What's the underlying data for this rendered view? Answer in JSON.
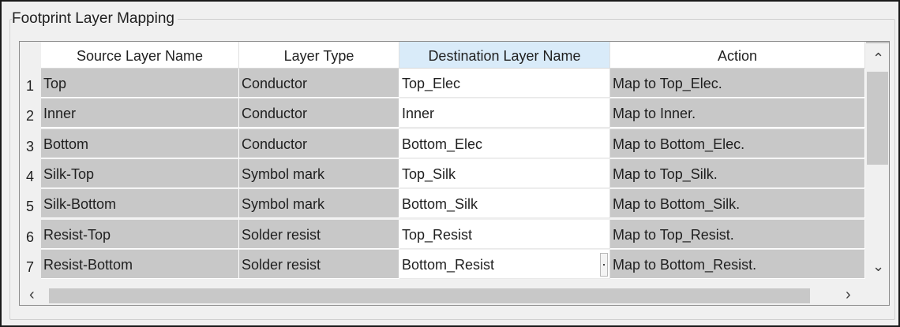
{
  "group": {
    "title": "Footprint Layer Mapping"
  },
  "columns": [
    "Source Layer Name",
    "Layer Type",
    "Destination Layer Name",
    "Action"
  ],
  "rows": [
    {
      "num": "1",
      "source": "Top",
      "type": "Conductor",
      "dest": "Top_Elec",
      "action": "Map to Top_Elec."
    },
    {
      "num": "2",
      "source": "Inner",
      "type": "Conductor",
      "dest": "Inner",
      "action": "Map to Inner."
    },
    {
      "num": "3",
      "source": "Bottom",
      "type": "Conductor",
      "dest": "Bottom_Elec",
      "action": "Map to Bottom_Elec."
    },
    {
      "num": "4",
      "source": "Silk-Top",
      "type": "Symbol mark",
      "dest": "Top_Silk",
      "action": "Map to Top_Silk."
    },
    {
      "num": "5",
      "source": "Silk-Bottom",
      "type": "Symbol mark",
      "dest": "Bottom_Silk",
      "action": "Map to Bottom_Silk."
    },
    {
      "num": "6",
      "source": "Resist-Top",
      "type": "Solder resist",
      "dest": "Top_Resist",
      "action": "Map to Top_Resist."
    },
    {
      "num": "7",
      "source": "Resist-Bottom",
      "type": "Solder resist",
      "dest": "Bottom_Resist",
      "action": "Map to Bottom_Resist."
    }
  ],
  "selected_column": 2,
  "icons": {
    "scroll_up": "chevron-up-icon",
    "scroll_down": "chevron-down-icon",
    "scroll_left": "chevron-left-icon",
    "scroll_right": "chevron-right-icon"
  }
}
